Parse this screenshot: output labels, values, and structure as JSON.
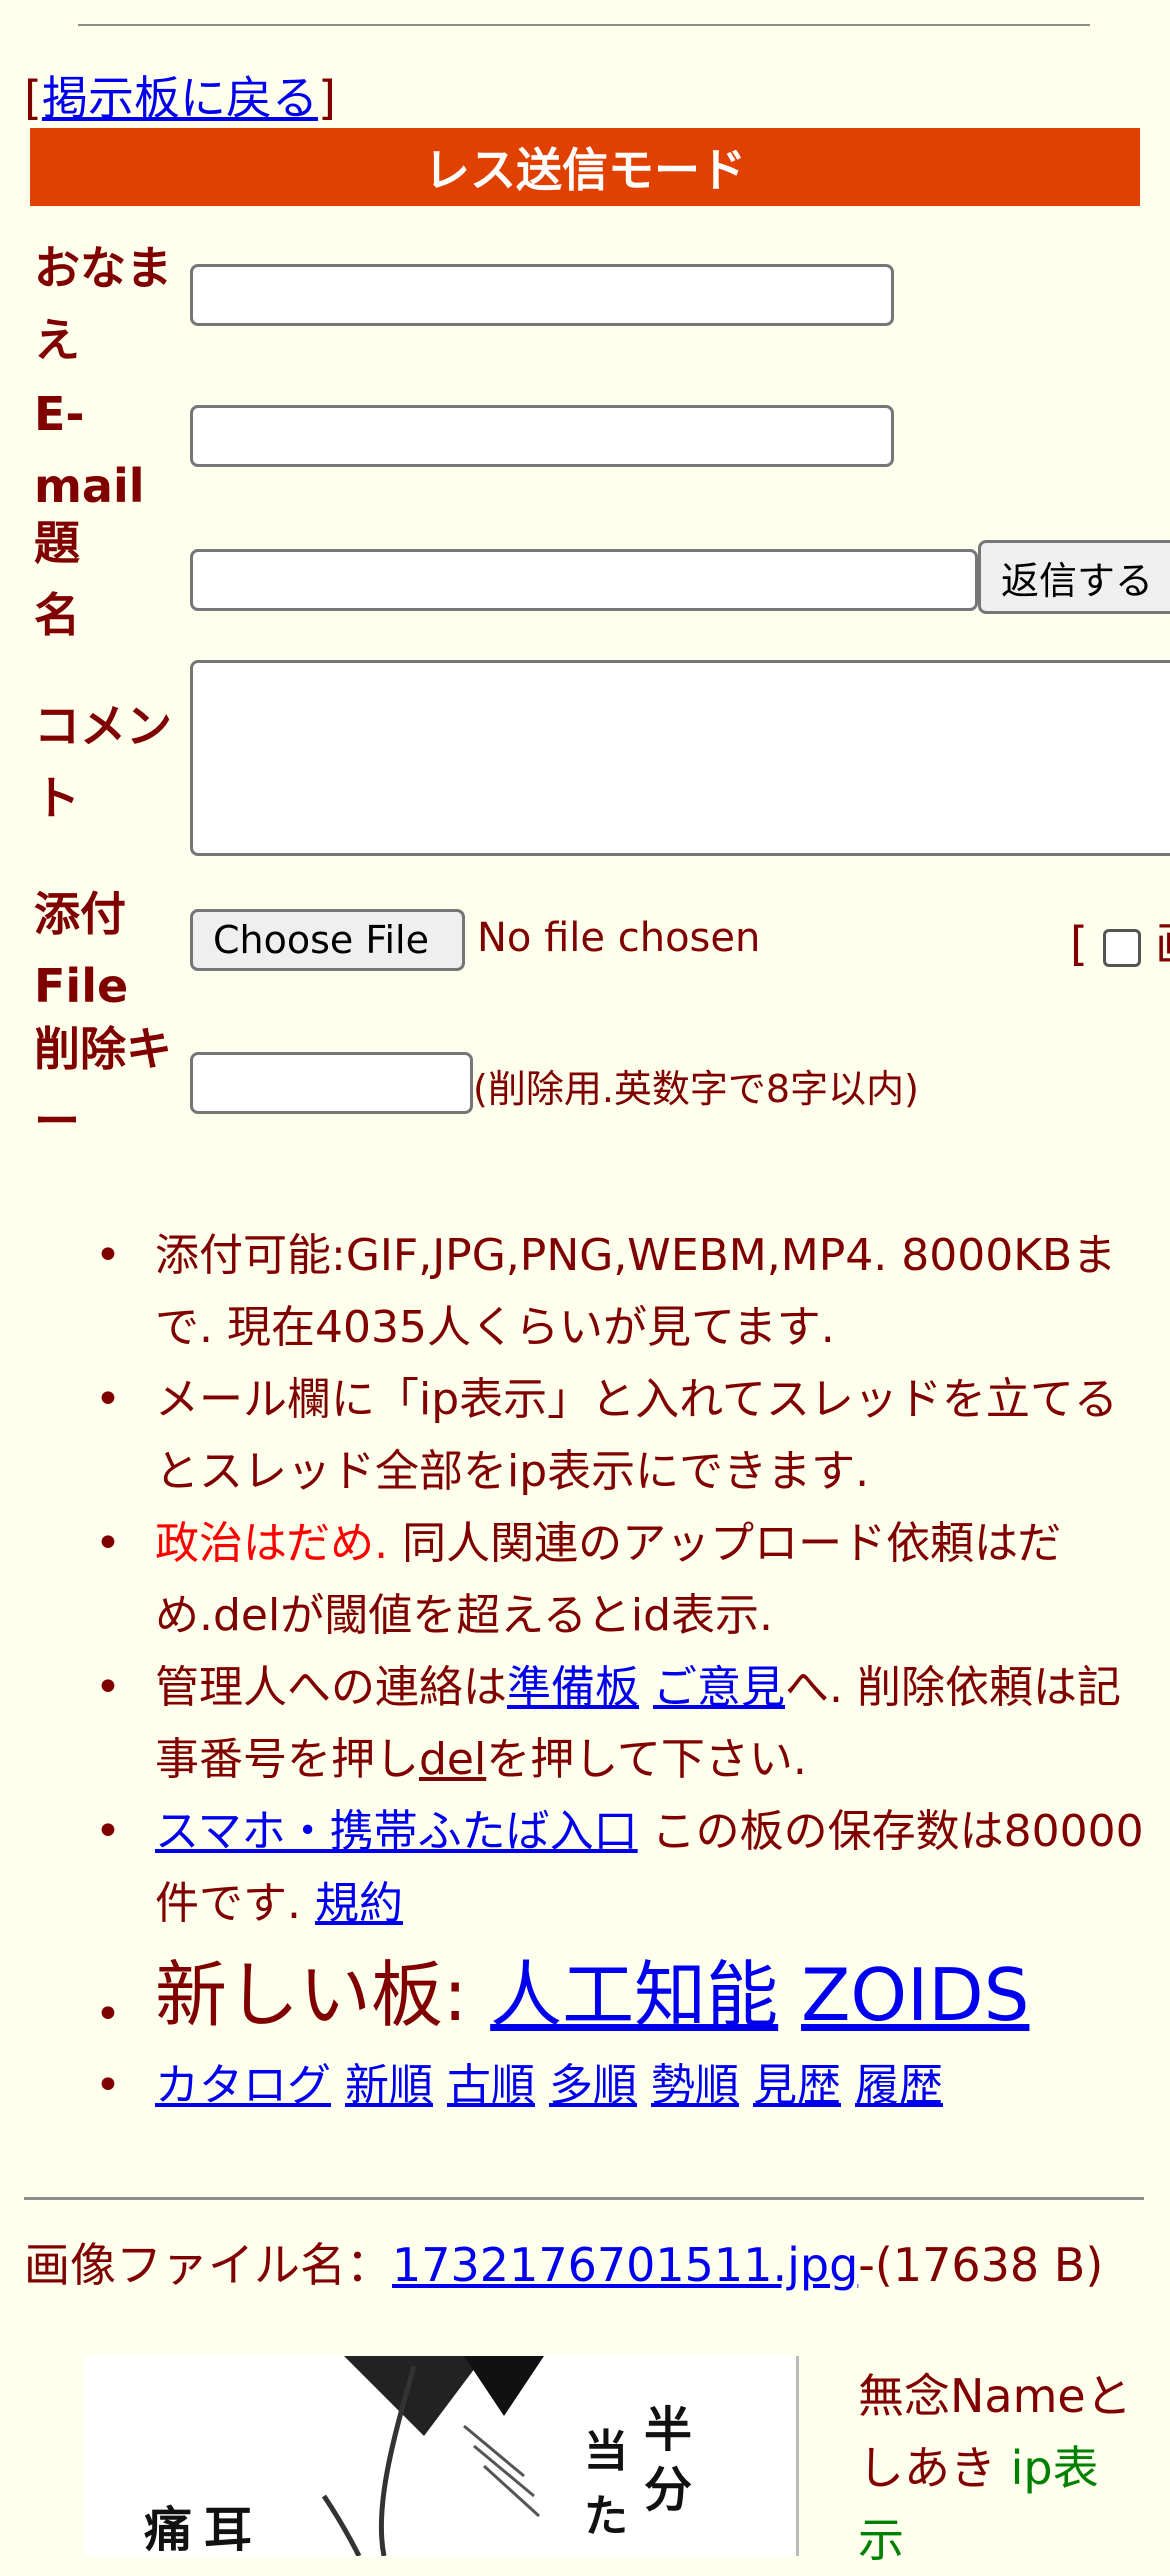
{
  "nav": {
    "open_bracket": "[",
    "back_link": "掲示板に戻る",
    "close_bracket": "]"
  },
  "form": {
    "title": "レス送信モード",
    "name_label": "おなまえ",
    "email_label": "E-mail",
    "subject_label": "題名",
    "comment_label": "コメント",
    "file_label": "添付File",
    "delkey_label": "削除キー",
    "submit_label": "返信する",
    "choose_file_label": "Choose File",
    "no_file_text": "No file chosen",
    "image_opt_prefix": "[",
    "image_opt_label": "画",
    "delkey_note": "(削除用.英数字で8字以内)"
  },
  "info": {
    "item1": "添付可能:GIF,JPG,PNG,WEBM,MP4. 8000KBまで. 現在4035人くらいが見てます.",
    "item2": "メール欄に「ip表示」と入れてスレッドを立てるとスレッド全部をip表示にできます.",
    "item3_red": "政治はだめ.",
    "item3_rest": " 同人関連のアップロード依頼はだめ.delが閾値を超えるとid表示.",
    "item4_pre": "管理人への連絡は",
    "item4_link1": "準備板",
    "item4_link2": "ご意見",
    "item4_mid": "へ. 削除依頼は記事番号を押し",
    "item4_link3": "del",
    "item4_post": "を押して下さい.",
    "item5_link": "スマホ・携帯ふたば入口",
    "item5_mid": " この板の保存数は80000件です. ",
    "item5_link2": "規約",
    "item6_prefix": "新しい板: ",
    "item6_link1": "人工知能",
    "item6_link2": "ZOIDS",
    "links": [
      "カタログ",
      "新順",
      "古順",
      "多順",
      "勢順",
      "見歴",
      "履歴"
    ]
  },
  "post": {
    "file_prefix": "画像ファイル名：",
    "file_link": "1732176701511.jpg",
    "file_size": "-(17638 B)",
    "name_text": "無念Nameとしあき",
    "ip_label": "ip表",
    "ip_cont": "示"
  },
  "colors": {
    "background": "#ffffee",
    "text": "#800000",
    "banner": "#e04000",
    "link": "#0000ee"
  }
}
